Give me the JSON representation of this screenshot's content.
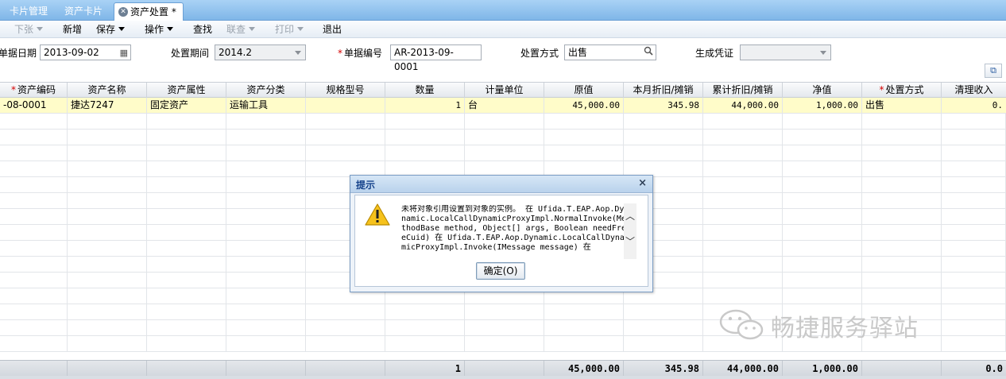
{
  "tabs": [
    {
      "label": "卡片管理"
    },
    {
      "label": "资产卡片"
    },
    {
      "label": "资产处置 *"
    }
  ],
  "toolbar": {
    "items": [
      {
        "label": "下张",
        "disabled": true,
        "has_menu": true
      },
      {
        "label": "新增",
        "disabled": false,
        "has_menu": false
      },
      {
        "label": "保存",
        "disabled": false,
        "has_menu": true
      },
      {
        "label": "操作",
        "disabled": false,
        "has_menu": true
      },
      {
        "label": "查找",
        "disabled": false,
        "has_menu": false
      },
      {
        "label": "联查",
        "disabled": true,
        "has_menu": true
      },
      {
        "label": "打印",
        "disabled": true,
        "has_menu": true
      },
      {
        "label": "退出",
        "disabled": false,
        "has_menu": false
      }
    ]
  },
  "form": {
    "doc_date_label": "单据日期",
    "doc_date_value": "2013-09-02",
    "period_label": "处置期间",
    "period_value": "2014.2",
    "doc_no_label": "单据编号",
    "doc_no_value": "AR-2013-09-0001",
    "method_label": "处置方式",
    "method_value": "出售",
    "voucher_label": "生成凭证",
    "voucher_value": ""
  },
  "grid": {
    "columns": [
      {
        "label": "资产编码",
        "required": true
      },
      {
        "label": "资产名称",
        "required": false
      },
      {
        "label": "资产属性",
        "required": false
      },
      {
        "label": "资产分类",
        "required": false
      },
      {
        "label": "规格型号",
        "required": false
      },
      {
        "label": "数量",
        "required": false
      },
      {
        "label": "计量单位",
        "required": false
      },
      {
        "label": "原值",
        "required": false
      },
      {
        "label": "本月折旧/摊销",
        "required": false
      },
      {
        "label": "累计折旧/摊销",
        "required": false
      },
      {
        "label": "净值",
        "required": false
      },
      {
        "label": "处置方式",
        "required": true
      },
      {
        "label": "清理收入",
        "required": false
      }
    ],
    "rows": [
      {
        "cells": [
          "-08-0001",
          "捷达7247",
          "固定资产",
          "运输工具",
          "",
          "1",
          "台",
          "45,000.00",
          "345.98",
          "44,000.00",
          "1,000.00",
          "出售",
          "0."
        ]
      }
    ],
    "totals": {
      "quantity": "1",
      "original_value": "45,000.00",
      "monthly_depr": "345.98",
      "accum_depr": "44,000.00",
      "net_value": "1,000.00",
      "clearance": "0.0"
    }
  },
  "dialog": {
    "title": "提示",
    "close_glyph": "×",
    "message": "未将对象引用设置到对象的实例。 在 Ufida.T.EAP.Aop.Dynamic.LocalCallDynamicProxyImpl.NormalInvoke(MethodBase method, Object[] args, Boolean needFreeCuid) 在 Ufida.T.EAP.Aop.Dynamic.LocalCallDynamicProxyImpl.Invoke(IMessage message) 在",
    "ok_label": "确定(O)"
  },
  "watermark": {
    "text": "畅捷服务驿站"
  },
  "colors": {
    "tab_bar": "#7fb6e8",
    "selected_row": "#fffcc9",
    "required_marker": "#d40000",
    "dialog_title_text": "#15428b"
  }
}
